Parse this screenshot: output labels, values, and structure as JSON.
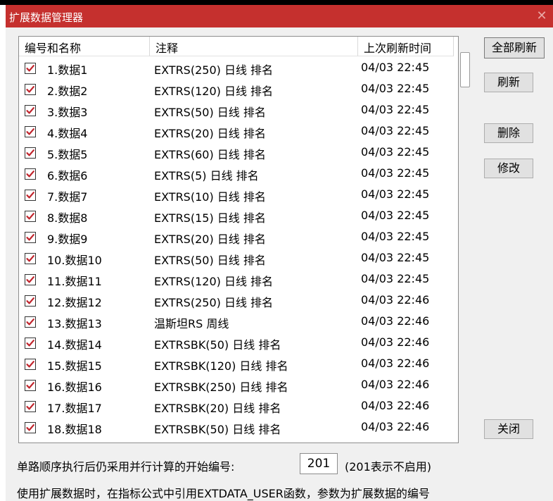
{
  "window": {
    "title": "扩展数据管理器",
    "close_glyph": "✕"
  },
  "columns": [
    "编号和名称",
    "注释",
    "上次刷新时间"
  ],
  "rows": [
    {
      "name": "1.数据1",
      "note": "EXTRS(250) 日线 排名",
      "time": "04/03 22:45",
      "checked": true
    },
    {
      "name": "2.数据2",
      "note": "EXTRS(120) 日线 排名",
      "time": "04/03 22:45",
      "checked": true
    },
    {
      "name": "3.数据3",
      "note": "EXTRS(50) 日线 排名",
      "time": "04/03 22:45",
      "checked": true
    },
    {
      "name": "4.数据4",
      "note": "EXTRS(20) 日线 排名",
      "time": "04/03 22:45",
      "checked": true
    },
    {
      "name": "5.数据5",
      "note": "EXTRS(60) 日线 排名",
      "time": "04/03 22:45",
      "checked": true
    },
    {
      "name": "6.数据6",
      "note": "EXTRS(5) 日线 排名",
      "time": "04/03 22:45",
      "checked": true
    },
    {
      "name": "7.数据7",
      "note": "EXTRS(10) 日线 排名",
      "time": "04/03 22:45",
      "checked": true
    },
    {
      "name": "8.数据8",
      "note": "EXTRS(15) 日线 排名",
      "time": "04/03 22:45",
      "checked": true
    },
    {
      "name": "9.数据9",
      "note": "EXTRS(20) 日线 排名",
      "time": "04/03 22:45",
      "checked": true
    },
    {
      "name": "10.数据10",
      "note": "EXTRS(50) 日线 排名",
      "time": "04/03 22:45",
      "checked": true
    },
    {
      "name": "11.数据11",
      "note": "EXTRS(120) 日线 排名",
      "time": "04/03 22:45",
      "checked": true
    },
    {
      "name": "12.数据12",
      "note": "EXTRS(250) 日线 排名",
      "time": "04/03 22:46",
      "checked": true
    },
    {
      "name": "13.数据13",
      "note": "温斯坦RS 周线",
      "time": "04/03 22:46",
      "checked": true
    },
    {
      "name": "14.数据14",
      "note": "EXTRSBK(50) 日线 排名",
      "time": "04/03 22:46",
      "checked": true
    },
    {
      "name": "15.数据15",
      "note": "EXTRSBK(120) 日线 排名",
      "time": "04/03 22:46",
      "checked": true
    },
    {
      "name": "16.数据16",
      "note": "EXTRSBK(250) 日线 排名",
      "time": "04/03 22:46",
      "checked": true
    },
    {
      "name": "17.数据17",
      "note": "EXTRSBK(20) 日线 排名",
      "time": "04/03 22:46",
      "checked": true
    },
    {
      "name": "18.数据18",
      "note": "EXTRSBK(50) 日线 排名",
      "time": "04/03 22:46",
      "checked": true
    }
  ],
  "buttons": {
    "refresh_all": "全部刷新",
    "refresh": "刷新",
    "delete": "删除",
    "modify": "修改",
    "close": "关闭"
  },
  "parallel": {
    "label": "单路顺序执行后仍采用并行计算的开始编号:",
    "value": "201",
    "note": "(201表示不启用)"
  },
  "footer": "使用扩展数据时，在指标公式中引用EXTDATA_USER函数，参数为扩展数据的编号",
  "colors": {
    "titlebar": "#c5302e",
    "check": "#c0242c"
  }
}
